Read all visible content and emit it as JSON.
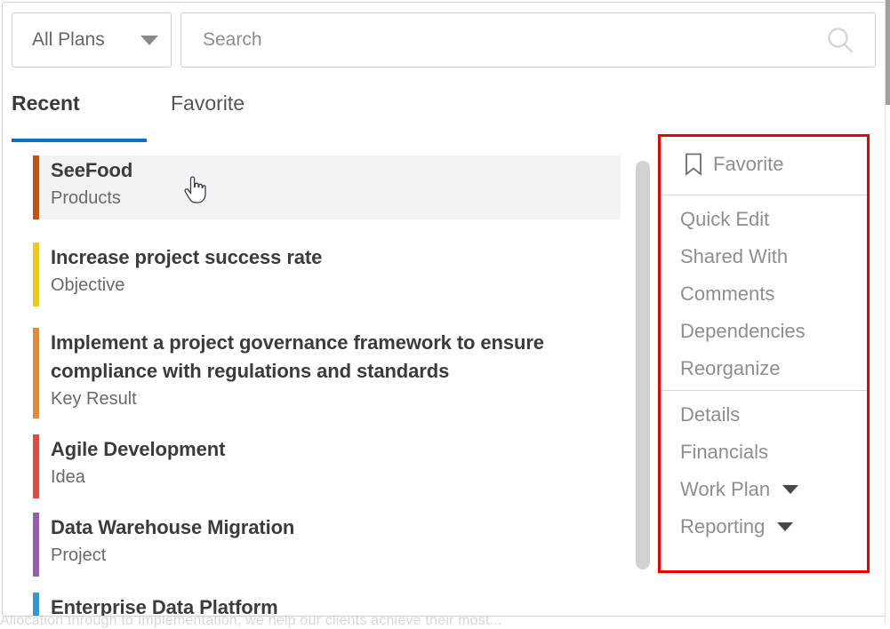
{
  "toolbar": {
    "plan_filter": {
      "label": "All Plans",
      "caret_icon": "chevron-down-icon"
    },
    "search": {
      "value": "",
      "placeholder": "Search",
      "icon": "search-icon"
    }
  },
  "tabs": [
    {
      "label": "Recent",
      "active": true
    },
    {
      "label": "Favorite",
      "active": false
    }
  ],
  "list": {
    "items": [
      {
        "title": "SeeFood",
        "type": "Products",
        "color": "#cc4f06",
        "hovered": true
      },
      {
        "title": "Increase project success rate",
        "type": "Objective",
        "color": "#f2c811",
        "hovered": false
      },
      {
        "title": "Implement a project governance framework to ensure compliance with regulations and standards",
        "type": "Key Result",
        "color": "#e8892a",
        "hovered": false
      },
      {
        "title": "Agile Development",
        "type": "Idea",
        "color": "#e8493c",
        "hovered": false
      },
      {
        "title": "Data Warehouse Migration",
        "type": "Project",
        "color": "#9c5bb0",
        "hovered": false
      },
      {
        "title": "Enterprise Data Platform",
        "type": "",
        "color": "#2a9ade",
        "hovered": false
      }
    ]
  },
  "action_menu": {
    "highlight_color": "#ee0000",
    "groups": [
      {
        "items": [
          {
            "label": "Favorite",
            "icon": "bookmark-icon",
            "has_caret": false
          }
        ]
      },
      {
        "items": [
          {
            "label": "Quick Edit",
            "has_caret": false
          },
          {
            "label": "Shared With",
            "has_caret": false
          },
          {
            "label": "Comments",
            "has_caret": false
          },
          {
            "label": "Dependencies",
            "has_caret": false
          },
          {
            "label": "Reorganize",
            "has_caret": false
          }
        ]
      },
      {
        "items": [
          {
            "label": "Details",
            "has_caret": false
          },
          {
            "label": "Financials",
            "has_caret": false
          },
          {
            "label": "Work Plan",
            "has_caret": true
          },
          {
            "label": "Reporting",
            "has_caret": true
          }
        ]
      }
    ]
  },
  "background": {
    "clipped_text": "Allocation through to Implementation, we help our clients achieve their most..."
  },
  "cursor": {
    "type": "pointer-hand-cursor"
  }
}
